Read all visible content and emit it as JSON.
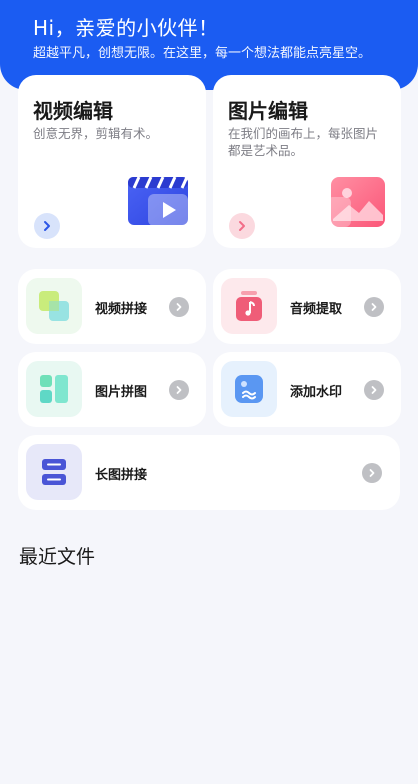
{
  "header": {
    "greeting": "Hi，亲爱的小伙伴！",
    "subtitle": "超越平凡，创想无限。在这里，每一个想法都能点亮星空。"
  },
  "feature_cards": [
    {
      "title": "视频编辑",
      "desc": "创意无界，剪辑有术。",
      "accent": "#3d5cf0",
      "icon": "video-clapper-icon"
    },
    {
      "title": "图片编辑",
      "desc": "在我们的画布上，每张图片都是艺术品。",
      "accent": "#fb6b8a",
      "icon": "image-icon"
    }
  ],
  "tools": [
    {
      "label": "视频拼接",
      "icon": "video-merge-icon"
    },
    {
      "label": "音频提取",
      "icon": "audio-extract-icon"
    },
    {
      "label": "图片拼图",
      "icon": "image-collage-icon"
    },
    {
      "label": "添加水印",
      "icon": "watermark-icon"
    },
    {
      "label": "长图拼接",
      "icon": "long-image-stitch-icon"
    }
  ],
  "recent": {
    "title": "最近文件"
  },
  "colors": {
    "header_bg": "#1b5cf2",
    "page_bg": "#f5f6fb",
    "arrow_gray": "#bfc0c4"
  }
}
